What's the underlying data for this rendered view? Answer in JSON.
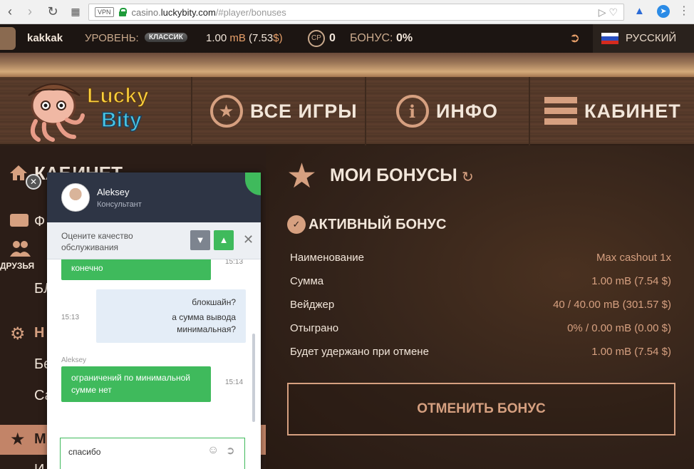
{
  "browser": {
    "vpn": "VPN",
    "url_pre": "casino.",
    "url_host": "luckybity.com",
    "url_path": "/#player/bonuses"
  },
  "topbar": {
    "username": "kakkak",
    "level_label": "УРОВЕНЬ:",
    "level_value": "КЛАССИК",
    "balance": "1.00",
    "balance_unit": "mB",
    "balance_usd": "(7.53",
    "balance_usd_unit": "$)",
    "cp_icon": "CP",
    "cp_value": "0",
    "bonus_label": "БОНУС:",
    "bonus_value": "0%",
    "language": "РУССКИЙ"
  },
  "logo": {
    "line1": "Lucky",
    "line2": "Bity"
  },
  "nav": {
    "games": "ВСЕ ИГРЫ",
    "info": "ИНФО",
    "cabinet": "КАБИНЕТ"
  },
  "sidebar": {
    "heading": "КАБИНЕТ",
    "friends": "ДРУЗЬЯ",
    "item_b": "БЛ",
    "section_n": "Н",
    "item_be": "Бе",
    "item_sa": "Са",
    "item_m": "М",
    "item_i": "И",
    "item_f": "Ф"
  },
  "chat": {
    "agent_name": "Aleksey",
    "agent_role": "Консультант",
    "rate_text": "Оцените качество обслуживания",
    "msg1": "конечно",
    "msg1_time": "15:13",
    "msg2_line1": "блокшайн?",
    "msg2_line2": "а сумма вывода минимальная?",
    "msg2_time": "15:13",
    "msg3_author": "Aleksey",
    "msg3": "ограничений по минимальной сумме нет",
    "msg3_time": "15:14",
    "input_value": "спасибо"
  },
  "bonuses": {
    "title": "МОИ БОНУСЫ",
    "active_title": "АКТИВНЫЙ БОНУС",
    "rows": [
      {
        "label": "Наименование",
        "value": "Max cashout 1x"
      },
      {
        "label": "Сумма",
        "value": "1.00 mB (7.54 $)"
      },
      {
        "label": "Вейджер",
        "value": "40 / 40.00 mB (301.57 $)"
      },
      {
        "label": "Отыграно",
        "value": "0% / 0.00 mB (0.00 $)"
      },
      {
        "label": "Будет удержано при отмене",
        "value": "1.00 mB (7.54 $)"
      }
    ],
    "cancel_button": "ОТМЕНИТЬ БОНУС"
  },
  "colors": {
    "accent": "#d6a080",
    "chat_green": "#3fba5c",
    "chat_header": "#2e3545"
  }
}
